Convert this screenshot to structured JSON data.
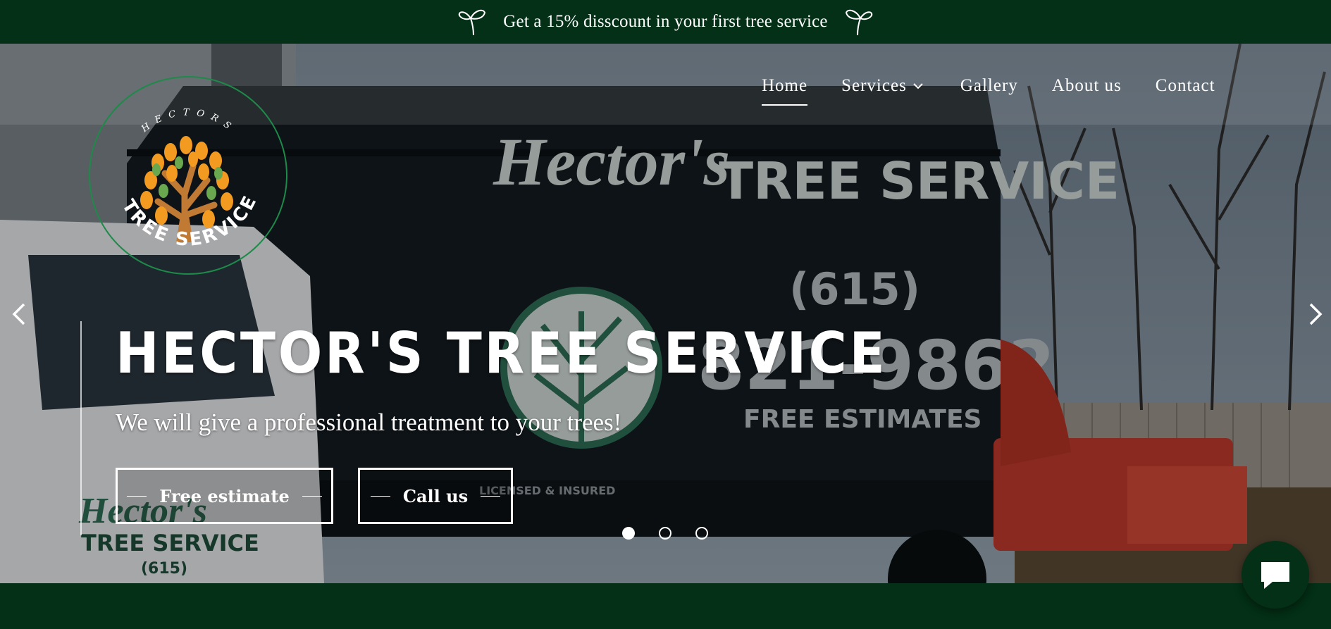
{
  "promo": {
    "text": "Get a 15% disscount in your first tree service",
    "left_icon": "sprout-icon",
    "right_icon": "sprout-icon"
  },
  "logo": {
    "top_text": "HECTORS",
    "bottom_text": "TREE SERVICE"
  },
  "nav": {
    "items": [
      {
        "label": "Home",
        "active": true
      },
      {
        "label": "Services",
        "has_dropdown": true
      },
      {
        "label": "Gallery"
      },
      {
        "label": "About us"
      },
      {
        "label": "Contact"
      }
    ]
  },
  "hero": {
    "title": "HECTOR'S TREE SERVICE",
    "subtitle": "We will give a professional treatment to your trees!",
    "buttons": {
      "estimate": "Free estimate",
      "call": "Call us"
    },
    "slider": {
      "count": 3,
      "active_index": 0
    }
  },
  "truck_lettering": {
    "brand": "Hector's",
    "line": "TREE SERVICE",
    "phone_area": "(615)",
    "phone": "821-9862",
    "free": "FREE ESTIMATES",
    "licensed": "LICENSED & INSURED"
  },
  "colors": {
    "brand_green": "#033016",
    "accent_orange": "#f39a21",
    "trunk_brown": "#c07a33",
    "leaf_green": "#6aa84f",
    "logo_ring": "#1e8a4a"
  }
}
